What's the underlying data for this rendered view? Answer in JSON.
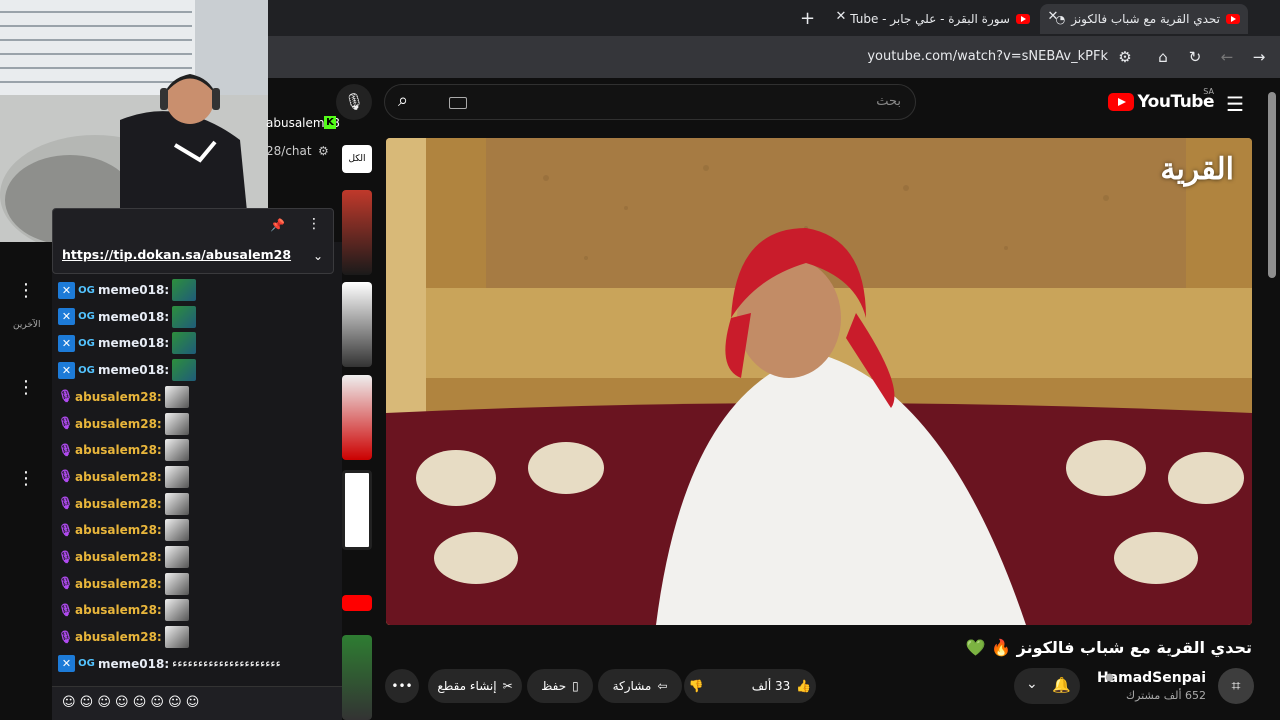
{
  "browser": {
    "tabs": [
      {
        "title": "تحدي القرية مع شباب فالكونز",
        "active": true
      },
      {
        "title": "سورة البقرة - علي جابر - YouTube",
        "active": false
      }
    ],
    "url": "youtube.com/watch?v=sNEBAv_kPFk"
  },
  "chat": {
    "streamer_partial": "abusalem28",
    "chat_path_partial": "28/chat",
    "pinned_link": "https://tip.dokan.sa/abusalem28",
    "messages": [
      {
        "user": "meme018:",
        "type": "meme"
      },
      {
        "user": "meme018:",
        "type": "meme"
      },
      {
        "user": "meme018:",
        "type": "meme"
      },
      {
        "user": "meme018:",
        "type": "meme"
      },
      {
        "user": "abusalem28:",
        "type": "abu"
      },
      {
        "user": "abusalem28:",
        "type": "abu"
      },
      {
        "user": "abusalem28:",
        "type": "abu"
      },
      {
        "user": "abusalem28:",
        "type": "abu"
      },
      {
        "user": "abusalem28:",
        "type": "abu"
      },
      {
        "user": "abusalem28:",
        "type": "abu"
      },
      {
        "user": "abusalem28:",
        "type": "abu"
      },
      {
        "user": "abusalem28:",
        "type": "abu"
      },
      {
        "user": "abusalem28:",
        "type": "abu"
      },
      {
        "user": "abusalem28:",
        "type": "abu"
      },
      {
        "user": "meme018:",
        "type": "meme",
        "text": "ءءءءءءءءءءءءءءءءءءءءء"
      }
    ],
    "side_label": "الآخرين",
    "filter_label": "الكل"
  },
  "youtube": {
    "logo": "YouTube",
    "country": "SA",
    "search_placeholder": "بحث",
    "video_overlay_text": "القرية",
    "video_title": "تحدي القرية مع شباب فالكونز 🔥 💚",
    "channel": {
      "name": "HamadSenpai",
      "subs": "652 ألف مشترك"
    },
    "actions": {
      "likes": "33 ألف",
      "share": "مشاركة",
      "save": "حفظ",
      "clip": "إنشاء مقطع"
    }
  }
}
